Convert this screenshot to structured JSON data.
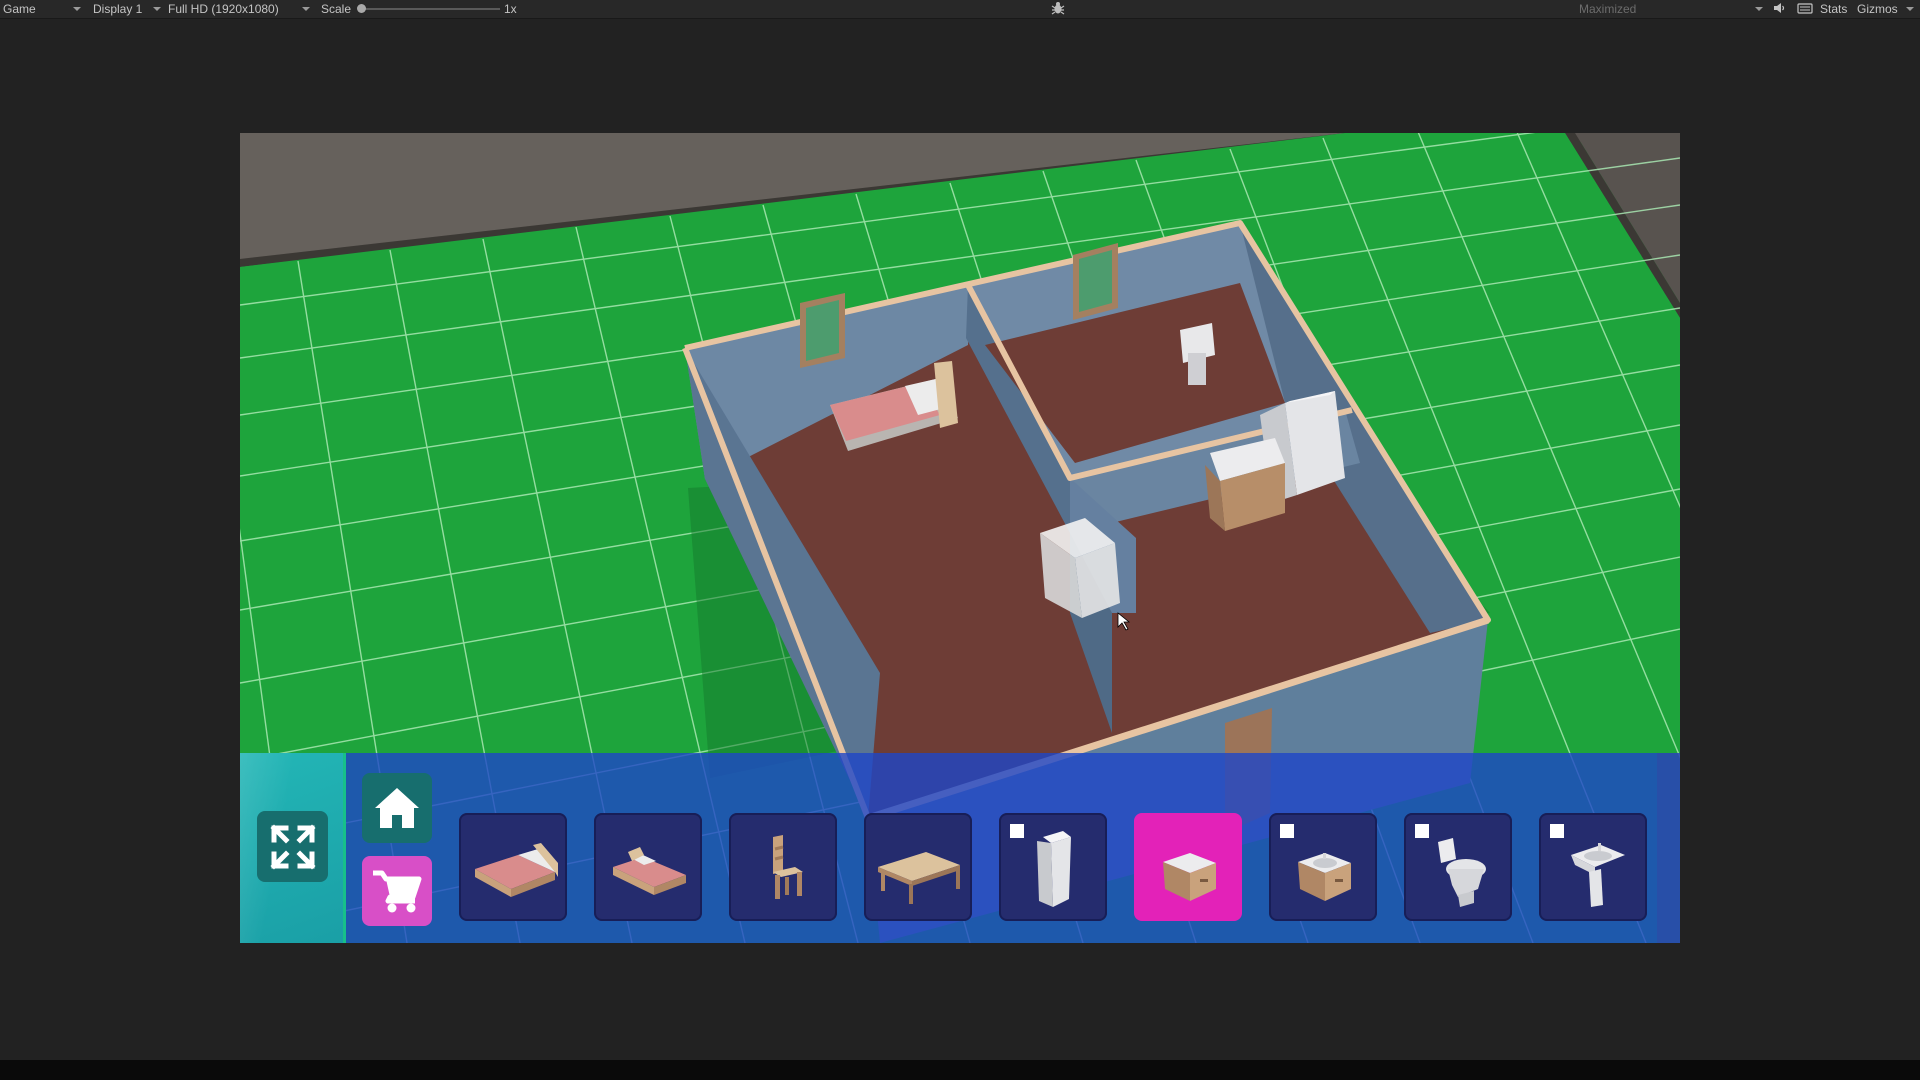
{
  "toolbar": {
    "game_tab": "Game",
    "display": "Display 1",
    "resolution": "Full HD (1920x1080)",
    "scale_label": "Scale",
    "scale_value": "1x",
    "maximized": "Maximized",
    "stats": "Stats",
    "gizmos": "Gizmos",
    "icons": [
      "bug-icon",
      "mute-audio-icon",
      "keyboard-icon"
    ]
  },
  "hud": {
    "left_buttons": [
      {
        "name": "fullscreen",
        "icon": "expand-arrows-icon",
        "color": "#176e6e"
      },
      {
        "name": "home",
        "icon": "house-icon",
        "color": "#176e6e"
      },
      {
        "name": "shop",
        "icon": "shopping-cart-icon",
        "color": "#d84fc7"
      }
    ],
    "items": [
      {
        "name": "double-bed",
        "icon": "double-bed-icon",
        "locked": false,
        "selected": false
      },
      {
        "name": "single-bed",
        "icon": "single-bed-icon",
        "locked": false,
        "selected": false
      },
      {
        "name": "chair",
        "icon": "chair-icon",
        "locked": false,
        "selected": false
      },
      {
        "name": "table",
        "icon": "table-icon",
        "locked": false,
        "selected": false
      },
      {
        "name": "fridge",
        "icon": "fridge-icon",
        "locked": true,
        "selected": false
      },
      {
        "name": "cabinet",
        "icon": "cabinet-icon",
        "locked": false,
        "selected": true
      },
      {
        "name": "sink-cabinet",
        "icon": "sink-cabinet-icon",
        "locked": true,
        "selected": false
      },
      {
        "name": "toilet",
        "icon": "toilet-icon",
        "locked": true,
        "selected": false
      },
      {
        "name": "pedestal-sink",
        "icon": "pedestal-sink-icon",
        "locked": true,
        "selected": false
      }
    ],
    "colors": {
      "panel": "#1e46c8",
      "slot": "#252c6e",
      "selected_slot": "#e322b8",
      "teal": "#23b6b6"
    }
  },
  "scene": {
    "colors": {
      "grass": "#1ea43c",
      "floor": "#6e3d36",
      "wall": "#5f7f9c",
      "wall_trim": "#e7c4a2",
      "road": "#5d5955"
    }
  }
}
